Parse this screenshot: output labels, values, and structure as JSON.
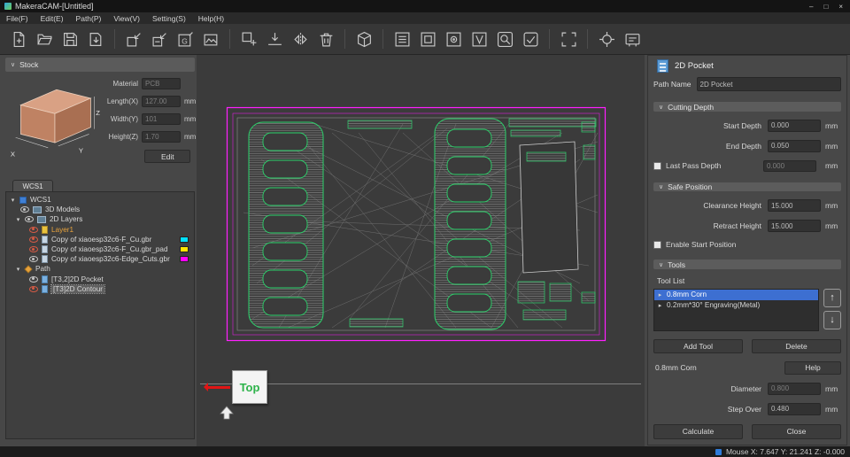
{
  "titlebar": {
    "title": "MakeraCAM-[Untitled]"
  },
  "window_controls": {
    "minimize": "–",
    "maximize": "□",
    "close": "×"
  },
  "menubar": {
    "items": [
      "File(F)",
      "Edit(E)",
      "Path(P)",
      "View(V)",
      "Setting(S)",
      "Help(H)"
    ]
  },
  "toolbar": {
    "icon_names": [
      "new-file",
      "open-file",
      "save-file",
      "save-as",
      "import-3d-model",
      "import-2d-vector",
      "import-gerber",
      "import-image",
      "add-shape",
      "push-to-plane",
      "mirror",
      "delete",
      "3d-view",
      "path-pocket",
      "path-contour",
      "path-drill",
      "path-engrave",
      "preview",
      "simulate",
      "fit-view",
      "set-origin",
      "machine-panel"
    ]
  },
  "icons": {
    "caret": "∨",
    "tree_open": "▾",
    "item_expand": "▸",
    "up_arrow": "↑",
    "down_arrow": "↓"
  },
  "stock": {
    "header": "Stock",
    "material_label": "Material",
    "material_value": "PCB",
    "length_label": "Length(X)",
    "length_value": "127.00",
    "width_label": "Width(Y)",
    "width_value": "101",
    "height_label": "Height(Z)",
    "height_value": "1.70",
    "unit": "mm",
    "edit_button": "Edit",
    "axis": {
      "x": "X",
      "y": "Y",
      "z": "Z"
    }
  },
  "tree": {
    "tab": "WCS1",
    "items": [
      {
        "label": "WCS1"
      },
      {
        "label": "3D Models"
      },
      {
        "label": "2D Layers"
      },
      {
        "label": "Layer1"
      },
      {
        "label": "Copy of xiaoesp32c6-F_Cu.gbr"
      },
      {
        "label": "Copy of xiaoesp32c6-F_Cu.gbr_pad"
      },
      {
        "label": "Copy of xiaoesp32c6-Edge_Cuts.gbr"
      },
      {
        "label": "Path"
      },
      {
        "label": "[T3,2]2D Pocket"
      },
      {
        "label": "[T3]2D Contour"
      }
    ],
    "swatch_styles": {
      "cu": "background:#00e0ff",
      "pad": "background:#ffe600",
      "edge": "background:#ff00ff"
    }
  },
  "canvas": {
    "view_label": "Top"
  },
  "colors": {
    "board_outline": "#ff1fff",
    "toolpath_green": "#2bd36b",
    "selection_blue": "#3d6fd1"
  },
  "inspector": {
    "title": "2D Pocket",
    "path_name_label": "Path Name",
    "path_name_value": "2D Pocket",
    "cutting_depth": {
      "header": "Cutting Depth",
      "rows": [
        {
          "label": "Start Depth",
          "value": "0.000",
          "unit": "mm"
        },
        {
          "label": "End Depth",
          "value": "0.050",
          "unit": "mm"
        },
        {
          "label": "Last Pass Depth",
          "value": "0.000",
          "unit": "mm"
        }
      ]
    },
    "safe_position": {
      "header": "Safe Position",
      "rows": [
        {
          "label": "Clearance Height",
          "value": "15.000",
          "unit": "mm"
        },
        {
          "label": "Retract Height",
          "value": "15.000",
          "unit": "mm"
        }
      ],
      "enable_start_label": "Enable Start Position"
    },
    "tools": {
      "header": "Tools",
      "tool_list_label": "Tool List",
      "items": [
        "0.8mm Corn",
        "0.2mm*30° Engraving(Metal)"
      ],
      "add_button": "Add Tool",
      "delete_button": "Delete",
      "current_tool": "0.8mm Corn",
      "help_button": "Help",
      "params": [
        {
          "label": "Diameter",
          "value": "0.800",
          "unit": "mm"
        },
        {
          "label": "Step Over",
          "value": "0.480",
          "unit": "mm"
        }
      ]
    },
    "calculate_button": "Calculate",
    "close_button": "Close"
  },
  "statusbar": {
    "mouse": "Mouse X: 7.647 Y: 21.241 Z: -0.000"
  }
}
